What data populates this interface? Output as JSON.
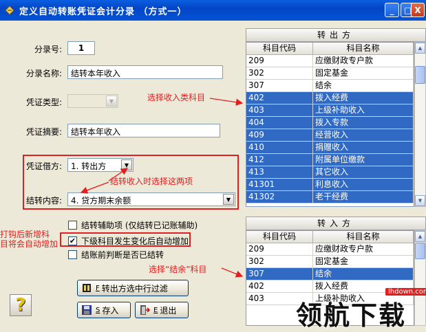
{
  "window": {
    "title": "定义自动转账凭证会计分录 （方式一）",
    "minimize_label": "_",
    "maximize_label": "□",
    "close_label": "X"
  },
  "form": {
    "entry_no_label": "分录号:",
    "entry_no_value": "1",
    "entry_name_label": "分录名称:",
    "entry_name_value": "结转本年收入",
    "voucher_type_label": "凭证类型:",
    "voucher_type_value": "",
    "voucher_summary_label": "凭证摘要:",
    "voucher_summary_value": "结转本年收入",
    "debit_side_label": "凭证借方:",
    "debit_side_value": "1. 转出方",
    "transfer_content_label": "结转内容:",
    "transfer_content_value": "4. 贷方期末余额"
  },
  "checkboxes": [
    {
      "label": "结转辅助项 (仅结转已记账辅助)",
      "checked": false
    },
    {
      "label": "下级科目发生变化后自动增加",
      "checked": true
    },
    {
      "label": "结账前判断是否已结转",
      "checked": false
    }
  ],
  "buttons": {
    "filter_label": "转出方选中行过滤",
    "filter_key": "F",
    "save_label": "存入",
    "save_key": "S",
    "exit_label": "退出",
    "exit_key": "E",
    "help_glyph": "?"
  },
  "annotations": {
    "select_income": "选择收入类科目",
    "select_both": "结转收入时选择这两项",
    "auto_add_line1": "打钩后新增科",
    "auto_add_line2": "目将会自动增加",
    "select_surplus": "选择“结余”科目"
  },
  "out_panel": {
    "title": "转出方",
    "col_code": "科目代码",
    "col_name": "科目名称",
    "rows": [
      {
        "code": "209",
        "name": "应缴财政专户款",
        "selected": false
      },
      {
        "code": "302",
        "name": "固定基金",
        "selected": false
      },
      {
        "code": "307",
        "name": "结余",
        "selected": false
      },
      {
        "code": "402",
        "name": "拨入经费",
        "selected": true
      },
      {
        "code": "403",
        "name": "上级补助收入",
        "selected": true
      },
      {
        "code": "404",
        "name": "拨入专款",
        "selected": true
      },
      {
        "code": "409",
        "name": "经营收入",
        "selected": true
      },
      {
        "code": "410",
        "name": "捐赠收入",
        "selected": true
      },
      {
        "code": "412",
        "name": "附属单位缴款",
        "selected": true
      },
      {
        "code": "413",
        "name": "其它收入",
        "selected": true
      },
      {
        "code": "41301",
        "name": "利息收入",
        "selected": true
      },
      {
        "code": "41302",
        "name": "老干经费",
        "selected": true
      }
    ]
  },
  "in_panel": {
    "title": "转入方",
    "col_code": "科目代码",
    "col_name": "科目名称",
    "rows": [
      {
        "code": "209",
        "name": "应缴财政专户款",
        "selected": false
      },
      {
        "code": "302",
        "name": "固定基金",
        "selected": false
      },
      {
        "code": "307",
        "name": "结余",
        "selected": true
      },
      {
        "code": "402",
        "name": "拨入经费",
        "selected": false
      },
      {
        "code": "403",
        "name": "上级补助收入",
        "selected": false
      }
    ]
  },
  "watermark": {
    "url": "lhdown.com",
    "brand": "领航下载"
  },
  "colors": {
    "selection": "#316ac5",
    "annotation_red": "#e02020",
    "titlebar_blue": "#0553d6"
  }
}
